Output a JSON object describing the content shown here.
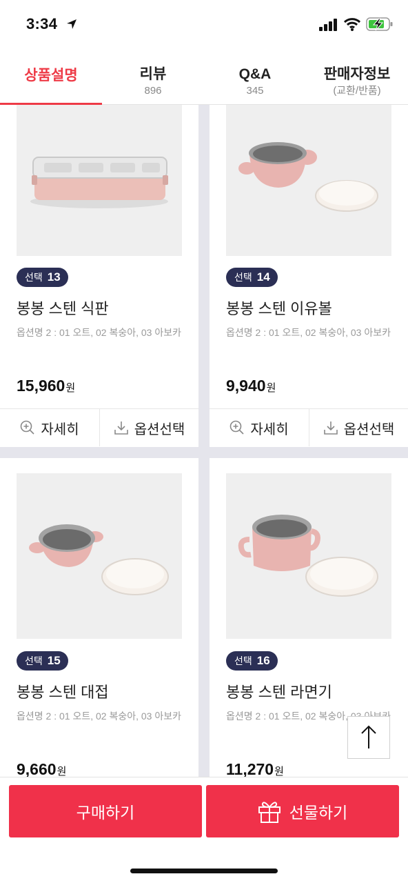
{
  "status_bar": {
    "time": "3:34"
  },
  "tabs": [
    {
      "label": "상품설명",
      "sub": ""
    },
    {
      "label": "리뷰",
      "sub": "896"
    },
    {
      "label": "Q&A",
      "sub": "345"
    },
    {
      "label": "판매자정보",
      "sub": "(교환/반품)"
    }
  ],
  "products": [
    {
      "badge_label": "선택",
      "badge_num": "13",
      "name": "봉봉 스텐 식판",
      "option": "옵션명 2 : 01 오트, 02 복숭아, 03 아보카",
      "price": "15,960",
      "currency": "원"
    },
    {
      "badge_label": "선택",
      "badge_num": "14",
      "name": "봉봉 스텐 이유볼",
      "option": "옵션명 2 : 01 오트, 02 복숭아, 03 아보카",
      "price": "9,940",
      "currency": "원"
    },
    {
      "badge_label": "선택",
      "badge_num": "15",
      "name": "봉봉 스텐 대접",
      "option": "옵션명 2 : 01 오트, 02 복숭아, 03 아보카",
      "price": "9,660",
      "currency": "원"
    },
    {
      "badge_label": "선택",
      "badge_num": "16",
      "name": "봉봉 스텐 라면기",
      "option": "옵션명 2 : 01 오트, 02 복숭아, 03 아보카",
      "price": "11,270",
      "currency": "원"
    }
  ],
  "card_actions": {
    "detail": "자세히",
    "option_select": "옵션선택"
  },
  "bottom_bar": {
    "buy": "구매하기",
    "gift": "선물하기"
  },
  "colors": {
    "accent": "#f0314a",
    "badge": "#2b2f55",
    "product_pink": "#e8b4b0"
  }
}
